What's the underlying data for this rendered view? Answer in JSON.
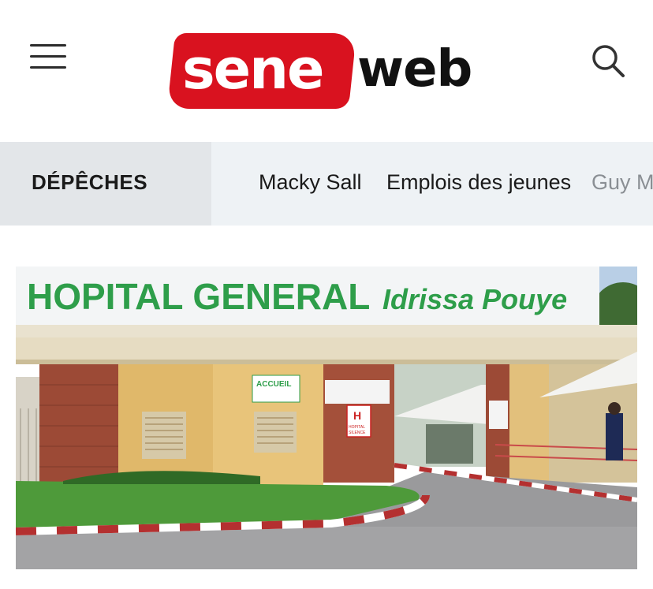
{
  "header": {
    "logo": {
      "part1": "sene",
      "part2": "web"
    },
    "menu_icon": "hamburger-menu-icon",
    "search_icon": "search-icon"
  },
  "nav": {
    "active": "DÉPÊCHES",
    "items": [
      "Macky Sall",
      "Emplois des jeunes",
      "Guy Ma"
    ]
  },
  "article": {
    "image": {
      "sign_main": "HOPITAL GENERAL",
      "sign_sub": "Idrissa Pouye",
      "small_sign_1": "ACCUEIL",
      "small_sign_2": "HOPITAL",
      "small_sign_3": "SILENCE"
    }
  },
  "colors": {
    "brand_red": "#d9121f",
    "nav_bg": "#eef2f5",
    "nav_active_bg": "#e3e6e9",
    "sign_green": "#2e9e4a"
  }
}
